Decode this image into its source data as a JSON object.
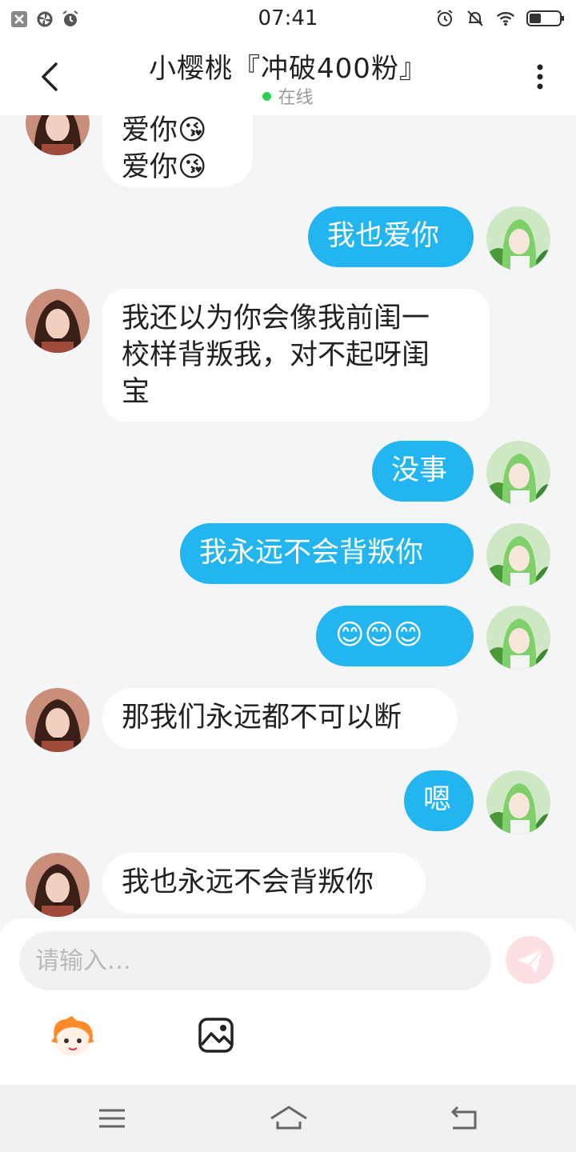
{
  "status_bar": {
    "time": "07:41"
  },
  "header": {
    "title": "小樱桃『冲破400粉』",
    "status": "在线"
  },
  "messages": [
    {
      "side": "in",
      "text": "爱你😘\n爱你😘"
    },
    {
      "side": "out",
      "text": "我也爱你"
    },
    {
      "side": "in",
      "text": "我还以为你会像我前闺一\n校样背叛我，对不起呀闺\n宝"
    },
    {
      "side": "out",
      "text": "没事"
    },
    {
      "side": "out",
      "text": "我永远不会背叛你"
    },
    {
      "side": "out",
      "text": "😊😊😊"
    },
    {
      "side": "in",
      "text": "那我们永远都不可以断"
    },
    {
      "side": "out",
      "text": "嗯"
    },
    {
      "side": "in",
      "text": "我也永远不会背叛你"
    }
  ],
  "composer": {
    "placeholder": "请输入…"
  },
  "colors": {
    "outgoing_bubble": "#22b5f0",
    "online_dot": "#2fcf55",
    "send_button": "#fde0e2"
  }
}
